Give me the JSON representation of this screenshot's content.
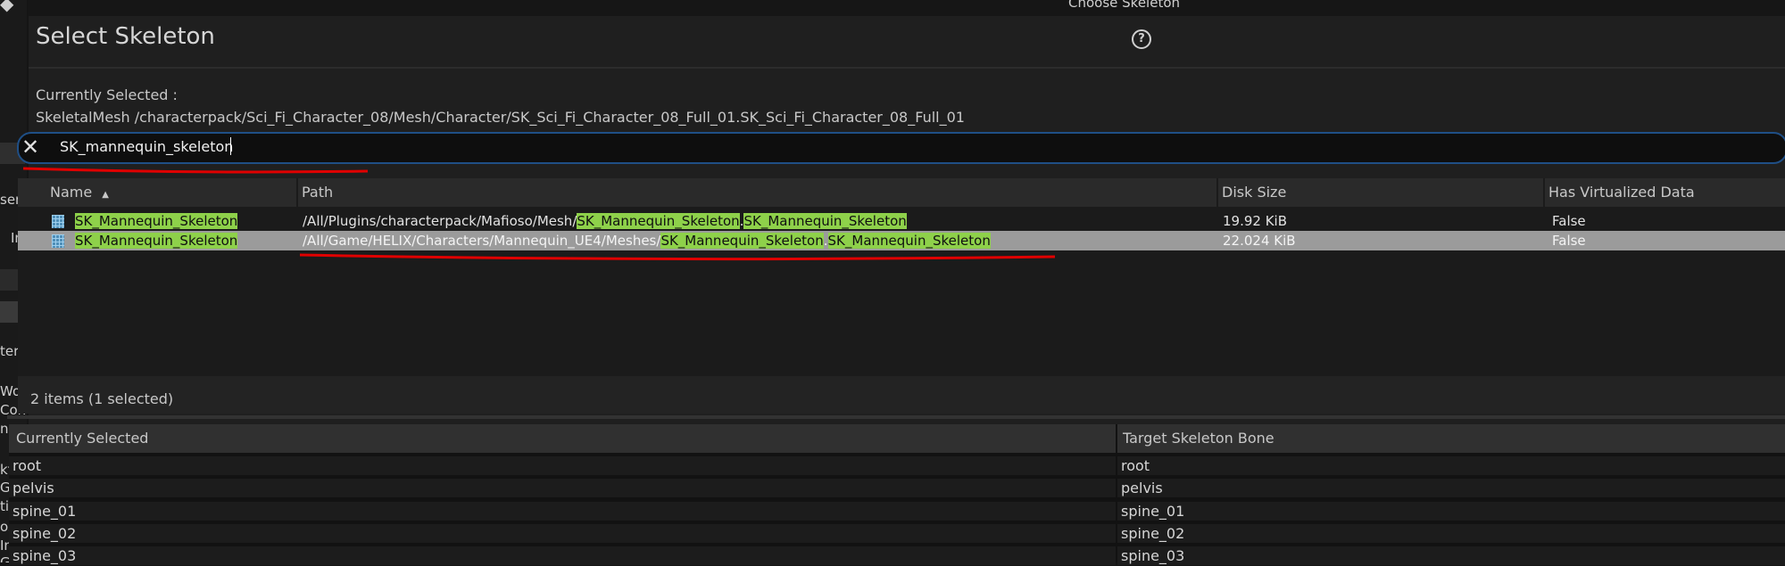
{
  "left_panel": {
    "fragments": [
      "ser",
      "In",
      "terS",
      "Worl",
      "Con",
      "nar",
      "kterp",
      "Girl",
      "tive",
      "oso",
      "In_S",
      "Gir"
    ]
  },
  "dialog": {
    "window_title": "Choose Skeleton",
    "title": "Select Skeleton",
    "help_icon": "question-circle-icon",
    "currently_selected_label": "Currently Selected :",
    "currently_selected_path": "SkeletalMesh /characterpack/Sci_Fi_Character_08/Mesh/Character/SK_Sci_Fi_Character_08_Full_01.SK_Sci_Fi_Character_08_Full_01"
  },
  "search": {
    "value": "SK_mannequin_skeleton",
    "clear_icon": "close-icon"
  },
  "results": {
    "columns": [
      "Name",
      "Path",
      "Disk Size",
      "Has Virtualized Data"
    ],
    "sort_indicator": "▲",
    "rows": [
      {
        "name": "SK_Mannequin_Skeleton",
        "path_prefix": "/All/Plugins/characterpack/Mafioso/Mesh/",
        "path_hl1": "SK_Mannequin_Skeleton",
        "path_dot": ".",
        "path_hl2": "SK_Mannequin_Skeleton",
        "disk_size": "19.92 KiB",
        "virtualized": "False",
        "selected": false
      },
      {
        "name": "SK_Mannequin_Skeleton",
        "path_prefix": "/All/Game/HELIX/Characters/Mannequin_UE4/Meshes/",
        "path_hl1": "SK_Mannequin_Skeleton",
        "path_dot": ".",
        "path_hl2": "SK_Mannequin_Skeleton",
        "disk_size": "22.024 KiB",
        "virtualized": "False",
        "selected": true
      }
    ],
    "status": "2 items (1 selected)"
  },
  "mapping": {
    "columns": [
      "Currently Selected",
      "Target Skeleton Bone"
    ],
    "rows": [
      {
        "current": "root",
        "target": "root"
      },
      {
        "current": "pelvis",
        "target": "pelvis"
      },
      {
        "current": "spine_01",
        "target": "spine_01"
      },
      {
        "current": "spine_02",
        "target": "spine_02"
      },
      {
        "current": "spine_03",
        "target": "spine_03"
      }
    ]
  },
  "colors": {
    "highlight": "#8ed14a",
    "annotation": "#e00000",
    "search_border": "#1f4f86",
    "selected_row": "#9b9b9b"
  }
}
